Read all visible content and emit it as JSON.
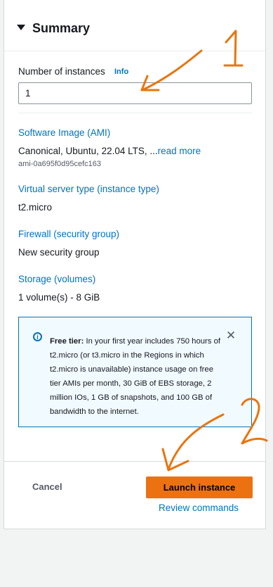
{
  "summary": {
    "title": "Summary",
    "instances_label": "Number of instances",
    "info_link": "Info",
    "instances_value": "1",
    "software_image_label": "Software Image (AMI)",
    "ami_text": "Canonical, Ubuntu, 22.04 LTS, ...",
    "read_more": "read more",
    "ami_id": "ami-0a695f0d95cefc163",
    "instance_type_label": "Virtual server type (instance type)",
    "instance_type_value": "t2.micro",
    "firewall_label": "Firewall (security group)",
    "firewall_value": "New security group",
    "storage_label": "Storage (volumes)",
    "storage_value": "1 volume(s) - 8 GiB"
  },
  "free_tier": {
    "bold": "Free tier:",
    "text": " In your first year includes 750 hours of t2.micro (or t3.micro in the Regions in which t2.micro is unavailable) instance usage on free tier AMIs per month, 30 GiB of EBS storage, 2 million IOs, 1 GB of snapshots, and 100 GB of bandwidth to the internet."
  },
  "footer": {
    "cancel": "Cancel",
    "launch": "Launch instance",
    "review": "Review commands"
  },
  "annotations": {
    "one": "1",
    "two": "2",
    "color": "#e8750f"
  },
  "icons": {
    "caret": "caret-down-icon",
    "info": "info-circle-icon",
    "close": "close-icon"
  }
}
